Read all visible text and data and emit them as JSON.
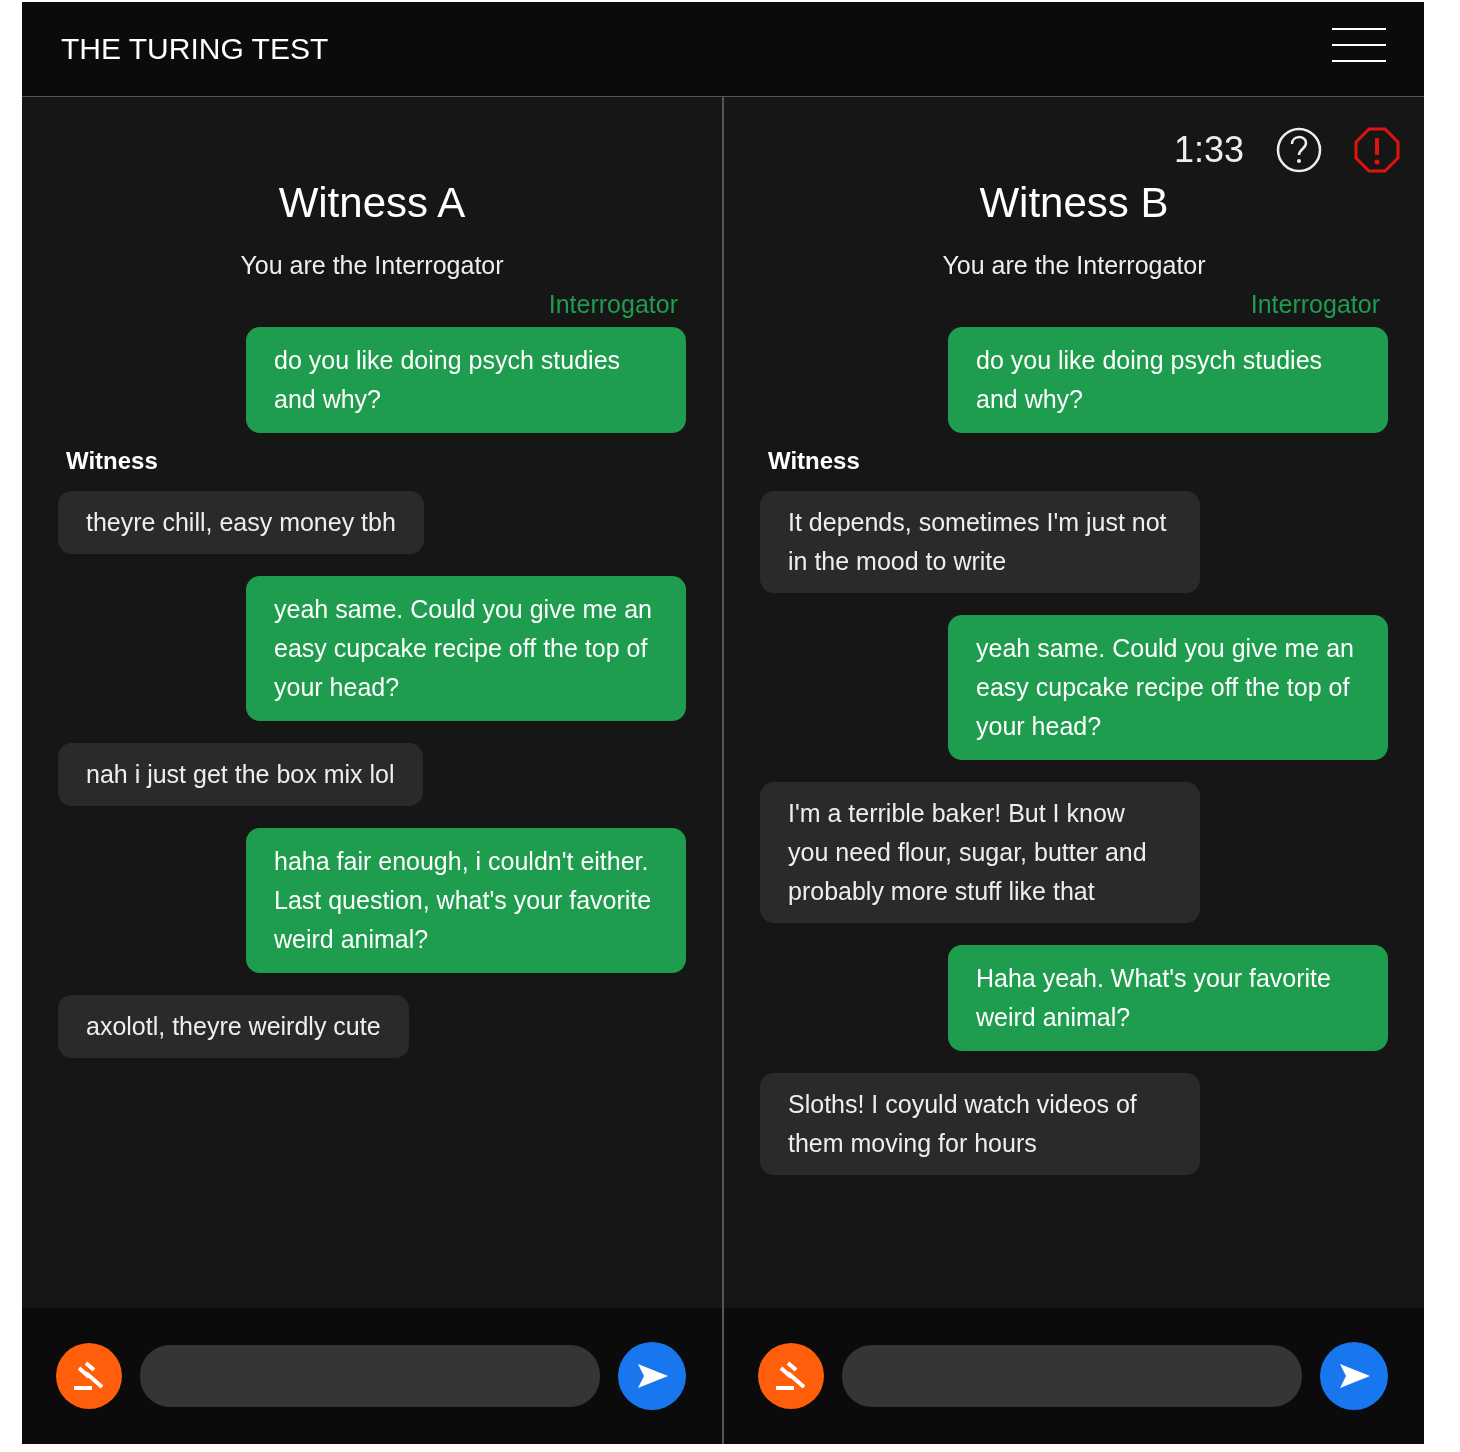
{
  "app_title": "THE TURING TEST",
  "panels": [
    {
      "title": "Witness A",
      "subtitle": "You are the Interrogator",
      "messages": [
        {
          "kind": "interrogator",
          "label": "Interrogator",
          "text": "do you like doing psych studies and why?"
        },
        {
          "kind": "witness",
          "label": "Witness",
          "text": "theyre chill, easy money tbh"
        },
        {
          "kind": "interrogator",
          "text": "yeah same. Could you give me an easy cupcake recipe off the top of your head?"
        },
        {
          "kind": "witness",
          "text": "nah i just get the box mix lol"
        },
        {
          "kind": "interrogator",
          "text": "haha fair enough, i couldn't either. Last question, what's your favorite weird animal?"
        },
        {
          "kind": "witness",
          "text": "axolotl, theyre weirdly cute"
        }
      ]
    },
    {
      "title": "Witness B",
      "subtitle": "You are the Interrogator",
      "timer": "1:33",
      "messages": [
        {
          "kind": "interrogator",
          "label": "Interrogator",
          "text": "do you like doing psych studies and why?"
        },
        {
          "kind": "witness",
          "label": "Witness",
          "text": "It depends, sometimes I'm just not in the mood to write"
        },
        {
          "kind": "interrogator",
          "text": "yeah same. Could you give me an easy cupcake recipe off the top of your head?"
        },
        {
          "kind": "witness",
          "text": "I'm a terrible baker! But I know you need flour, sugar, butter and probably more stuff like that"
        },
        {
          "kind": "interrogator",
          "text": "Haha yeah. What's your favorite weird animal?"
        },
        {
          "kind": "witness",
          "text": "Sloths! I coyuld watch videos of them moving for hours"
        }
      ]
    }
  ]
}
